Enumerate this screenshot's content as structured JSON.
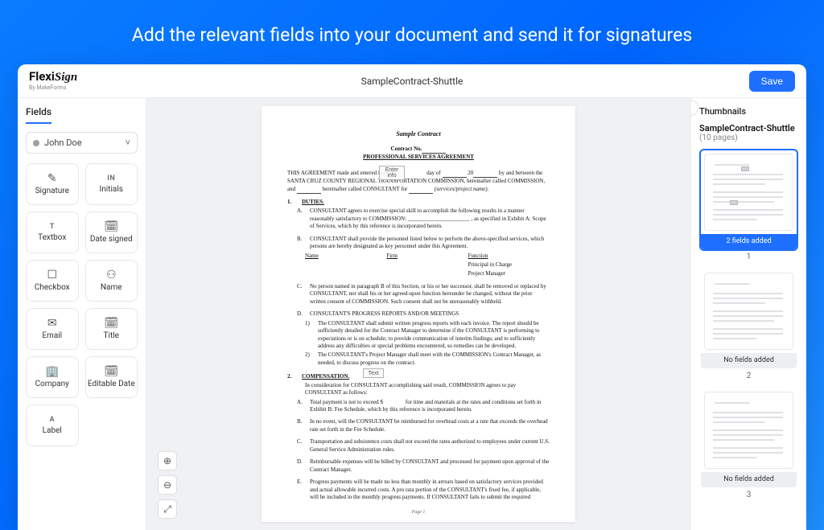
{
  "headline": "Add the relevant fields into your document and send it for signatures",
  "brand": {
    "flexi": "Flexi",
    "sign": "Sign",
    "sub": "By MakeForms"
  },
  "doc_title": "SampleContract-Shuttle",
  "save": "Save",
  "left": {
    "title": "Fields",
    "signer": "John Doe",
    "tiles": [
      {
        "icon": "✎",
        "label": "Signature"
      },
      {
        "icon": "IN",
        "label": "Initials",
        "icon_txt": true
      },
      {
        "icon": "T",
        "label": "Textbox",
        "icon_txt": true
      },
      {
        "icon": "🗓",
        "label": "Date signed"
      },
      {
        "icon": "☐",
        "label": "Checkbox"
      },
      {
        "icon": "⚇",
        "label": "Name"
      },
      {
        "icon": "✉",
        "label": "Email"
      },
      {
        "icon": "🗓",
        "label": "Title"
      },
      {
        "icon": "🏢",
        "label": "Company"
      },
      {
        "icon": "🗓",
        "label": "Editable Date"
      },
      {
        "icon": "A",
        "label": "Label",
        "icon_txt": true
      }
    ]
  },
  "overlays": {
    "enter_info": "Enter\ninfo",
    "text": "Text"
  },
  "doc": {
    "sample": "Sample Contract",
    "contract_no": "Contract No.",
    "psa": "PROFESSIONAL SERVICES AGREEMENT",
    "intro_a": "THIS AGREEMENT made and entered into this",
    "intro_b": "day of",
    "intro_c": "20",
    "intro_d": "by and between the SANTA CRUZ COUNTY REGIONAL TRANSPORTATION COMMISSION, hereinafter called COMMISSION, and",
    "intro_e": "hereinafter called CONSULTANT for",
    "intro_f": "(services/project name).",
    "s1_num": "1.",
    "s1_hdr": "DUTIES.",
    "s1a_lbl": "A.",
    "s1a": "CONSULTANT agrees to exercise special skill to accomplish the following results in a manner reasonably satisfactory to COMMISSION: ______________________ , as specified in Exhibit A: Scope of Services, which by this reference is incorporated herein.",
    "s1b_lbl": "B.",
    "s1b": "CONSULTANT shall provide the personnel listed below to perform the above-specified services, which persons are hereby designated as key personnel under this Agreement.",
    "col_name": "Name",
    "col_firm": "Firm",
    "col_func": "Function",
    "role1": "Principal in Charge",
    "role2": "Project Manager",
    "s1c_lbl": "C.",
    "s1c": "No person named in paragraph B of this Section, or his or her successor, shall be removed or replaced by CONSULTANT, nor shall his or her agreed-upon function hereunder be changed, without the prior written consent of COMMISSION. Such consent shall not be unreasonably withheld.",
    "s1d_lbl": "D.",
    "s1d_hdr": "CONSULTANT'S PROGRESS REPORTS AND/OR MEETINGS",
    "s1d1_lbl": "1)",
    "s1d1": "The CONSULTANT shall submit written progress reports with each invoice. The report should be sufficiently detailed for the Contract Manager to determine if the CONSULTANT is performing to expectations or is on schedule; to provide communication of interim findings; and to sufficiently address any difficulties or special problems encountered, so remedies can be developed.",
    "s1d2_lbl": "2)",
    "s1d2": "The CONSULTANT's Project Manager shall meet with the COMMISSION's Contract Manager, as needed, to discuss progress on the contract.",
    "s2_num": "2.",
    "s2_hdr": "COMPENSATION.",
    "s2_intro": "In consideration for CONSULTANT accomplishing said result, COMMISSION agrees to pay CONSULTANT as follows:",
    "s2a_lbl": "A.",
    "s2a_a": "Total payment is not to exceed $",
    "s2a_b": "for time and materials at the rates and conditions set forth in Exhibit B: Fee Schedule, which by this reference is incorporated herein.",
    "s2b_lbl": "B.",
    "s2b": "In no event, will the CONSULTANT be reimbursed for overhead costs at a rate that exceeds the overhead rate set forth in the Fee Schedule.",
    "s2c_lbl": "C.",
    "s2c": "Transportation and subsistence costs shall not exceed the rates authorized to employees under current U.S. General Service Administration rules.",
    "s2d_lbl": "D.",
    "s2d": "Reimbursable expenses will be billed by CONSULTANT and processed for payment upon approval of the Contract Manager.",
    "s2e_lbl": "E.",
    "s2e": "Progress payments will be made no less than monthly in arrears based on satisfactory services provided and actual allowable incurred costs. A pro rata portion of the CONSULTANT's fixed fee, if applicable, will be included in the monthly progress payments. If CONSULTANT fails to submit the required",
    "page_lbl": "Page 1"
  },
  "right": {
    "title": "Thumbnails",
    "doc_name": "SampleContract-Shuttle",
    "pages": "(10 pages)",
    "badge_added": "2 fields added",
    "badge_none": "No fields added",
    "n1": "1",
    "n2": "2",
    "n3": "3"
  }
}
